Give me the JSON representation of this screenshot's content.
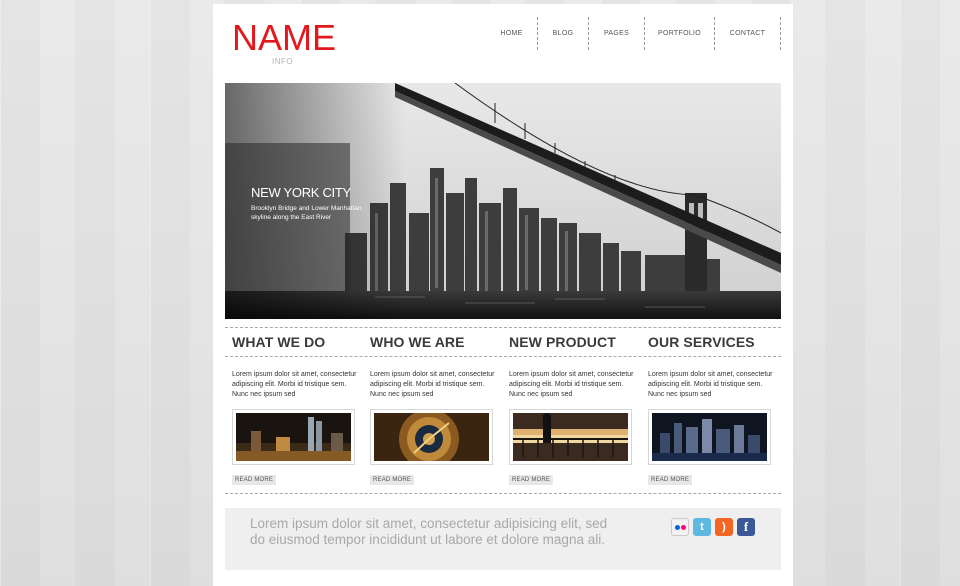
{
  "header": {
    "logo": "NAME",
    "logo_sub": "INFO",
    "nav": [
      "HOME",
      "BLOG",
      "PAGES",
      "PORTFOLIO",
      "CONTACT"
    ]
  },
  "hero": {
    "title": "NEW YORK CITY",
    "subtitle": "Brooklyn Bridge and Lower Manhattan skyline along the East River"
  },
  "columns": [
    {
      "title": "WHAT WE DO",
      "text": "Lorem ipsum dolor sit amet, consectetur adipiscing elit. Morbi id tristique sem. Nunc nec ipsum sed",
      "read_more": "READ MORE",
      "image": "city-night-towers-thumbnail"
    },
    {
      "title": "WHO WE ARE",
      "text": "Lorem ipsum dolor sit amet, consectetur adipiscing elit. Morbi id tristique sem. Nunc nec ipsum sed",
      "read_more": "READ MORE",
      "image": "astronomical-clock-thumbnail"
    },
    {
      "title": "NEW PRODUCT",
      "text": "Lorem ipsum dolor sit amet, consectetur adipiscing elit. Morbi id tristique sem. Nunc nec ipsum sed",
      "read_more": "READ MORE",
      "image": "sunset-railing-silhouette-thumbnail"
    },
    {
      "title": "OUR SERVICES",
      "text": "Lorem ipsum dolor sit amet, consectetur adipiscing elit. Morbi id tristique sem. Nunc nec ipsum sed",
      "read_more": "READ MORE",
      "image": "night-skyline-thumbnail"
    }
  ],
  "footer": {
    "text": "Lorem ipsum dolor sit amet, consectetur adipisicing elit, sed do eiusmod tempor incididunt ut labore et dolore magna ali.",
    "social": [
      {
        "icon": "flickr-icon",
        "glyph": ""
      },
      {
        "icon": "twitter-icon",
        "glyph": "t"
      },
      {
        "icon": "rss-icon",
        "glyph": ")"
      },
      {
        "icon": "facebook-icon",
        "glyph": "f"
      }
    ]
  },
  "colors": {
    "logo": "#e2181c",
    "page_background": "#ffffff",
    "text_dark": "#3a3a3a",
    "footer_band": "#efefef"
  }
}
